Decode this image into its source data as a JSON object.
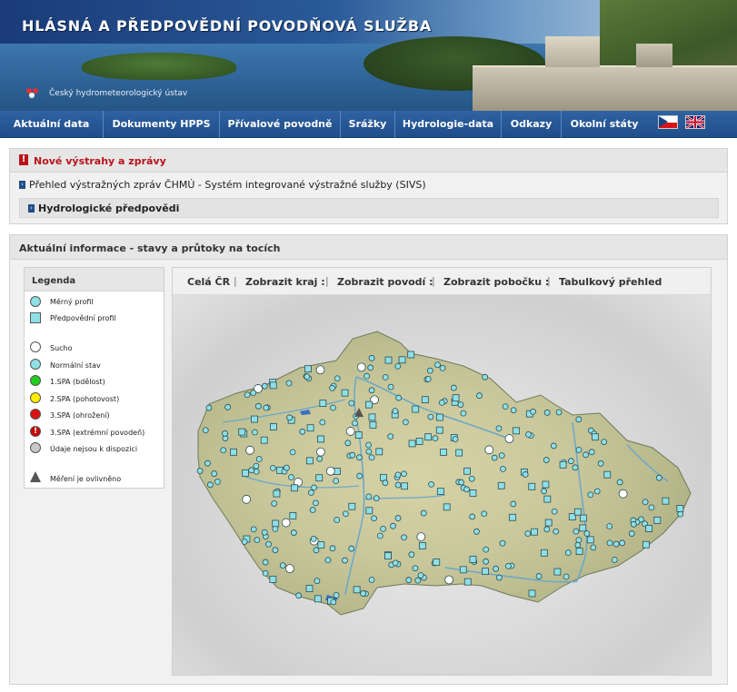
{
  "header": {
    "site_title": "HLÁSNÁ A PŘEDPOVĚDNÍ POVODŇOVÁ SLUŽBA",
    "institute": "Český hydrometeorologický ústav"
  },
  "menu": {
    "items": [
      "Aktuální data",
      "Dokumenty HPPS",
      "Přívalové povodně",
      "Srážky",
      "Hydrologie-data",
      "Odkazy",
      "Okolní státy"
    ]
  },
  "alerts": {
    "title": "Nové výstrahy a zprávy",
    "sivs_link": "Přehled výstražných zpráv ČHMÚ - Systém integrované výstražné služby (SIVS)",
    "hydro_pred": "Hydrologické předpovědi"
  },
  "main": {
    "title": "Aktuální informace - stavy a průtoky na tocích"
  },
  "legend": {
    "title": "Legenda",
    "items": [
      {
        "label": "Měrný profil",
        "icon": "circle",
        "color": "#8fe0e6"
      },
      {
        "label": "Předpovědní profil",
        "icon": "square",
        "color": "#8fe0e6"
      },
      {
        "label": "Sucho",
        "icon": "circle",
        "color": "#ffffff"
      },
      {
        "label": "Normální stav",
        "icon": "circle",
        "color": "#8fe0e6"
      },
      {
        "label": "1.SPA (bdělost)",
        "icon": "circle",
        "color": "#22cc22"
      },
      {
        "label": "2.SPA (pohotovost)",
        "icon": "circle",
        "color": "#ffee00"
      },
      {
        "label": "3.SPA (ohrožení)",
        "icon": "circle",
        "color": "#dd1111"
      },
      {
        "label": "3.SPA (extrémní povodeň)",
        "icon": "circle-exclamation",
        "color": "#cc0000"
      },
      {
        "label": "Údaje nejsou k dispozici",
        "icon": "circle",
        "color": "#c8c8c8"
      },
      {
        "label": "Měření je ovlivněno",
        "icon": "triangle",
        "color": "#555555"
      }
    ]
  },
  "map_toolbar": {
    "items": [
      "Celá ČR",
      "Zobrazit kraj :",
      "Zobrazit povodí :",
      "Zobrazit pobočku :",
      "Tabulkový přehled"
    ]
  },
  "colors": {
    "menu_bg": "#2a5a98",
    "alert_red": "#b9131b",
    "station_normal": "#8fe0e6",
    "terrain": "#c8c9a0",
    "river": "#6aa7c9"
  }
}
